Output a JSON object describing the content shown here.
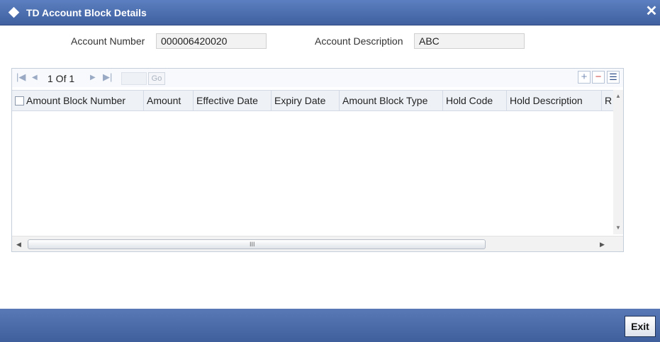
{
  "window": {
    "title": "TD Account Block Details",
    "close_symbol": "✕"
  },
  "fields": {
    "account_number_label": "Account Number",
    "account_number_value": "000006420020",
    "account_description_label": "Account Description",
    "account_description_value": "ABC"
  },
  "grid": {
    "pager": {
      "text": "1 Of 1",
      "page_value": "",
      "go_label": "Go"
    },
    "toolbar": {
      "add_symbol": "+",
      "remove_symbol": "−",
      "view_symbol": "☰"
    },
    "columns": [
      "Amount Block Number",
      "Amount",
      "Effective Date",
      "Expiry Date",
      "Amount Block Type",
      "Hold Code",
      "Hold Description",
      "R"
    ],
    "rows": [],
    "hscroll_grip": "III"
  },
  "footer": {
    "exit_label": "Exit"
  },
  "icons": {
    "first": "first-page-icon",
    "prev": "prev-page-icon",
    "next": "next-page-icon",
    "last": "last-page-icon",
    "add": "add-row-icon",
    "remove": "remove-row-icon",
    "view": "single-view-icon"
  },
  "colors": {
    "titlebar": "#4a6cae",
    "footer": "#4a6cae",
    "header_bg": "#eef2f7"
  }
}
